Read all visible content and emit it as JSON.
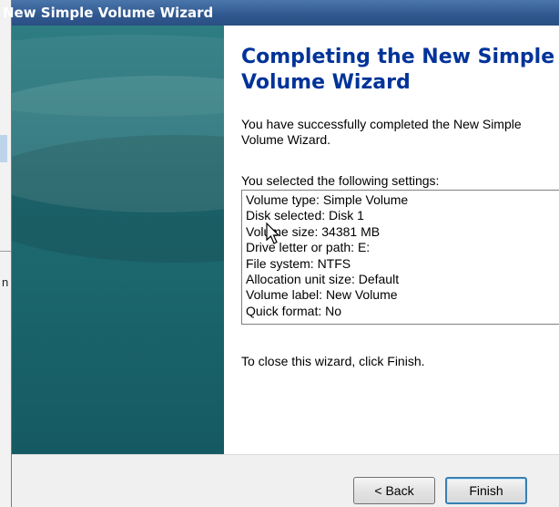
{
  "window": {
    "title": "New Simple Volume Wizard"
  },
  "background": {
    "edge_char": "n"
  },
  "content": {
    "heading": "Completing the New Simple Volume Wizard",
    "success_text": "You have successfully completed the New Simple Volume Wizard.",
    "settings_label": "You selected the following settings:",
    "settings": [
      "Volume type: Simple Volume",
      "Disk selected: Disk 1",
      "Volume size: 34381 MB",
      "Drive letter or path: E:",
      "File system: NTFS",
      "Allocation unit size: Default",
      "Volume label: New Volume",
      "Quick format: No"
    ],
    "close_text": "To close this wizard, click Finish."
  },
  "buttons": {
    "back": "< Back",
    "finish": "Finish"
  },
  "colors": {
    "heading": "#003399",
    "title_bar": "#30588f",
    "side_panel": "#1f6b72"
  }
}
